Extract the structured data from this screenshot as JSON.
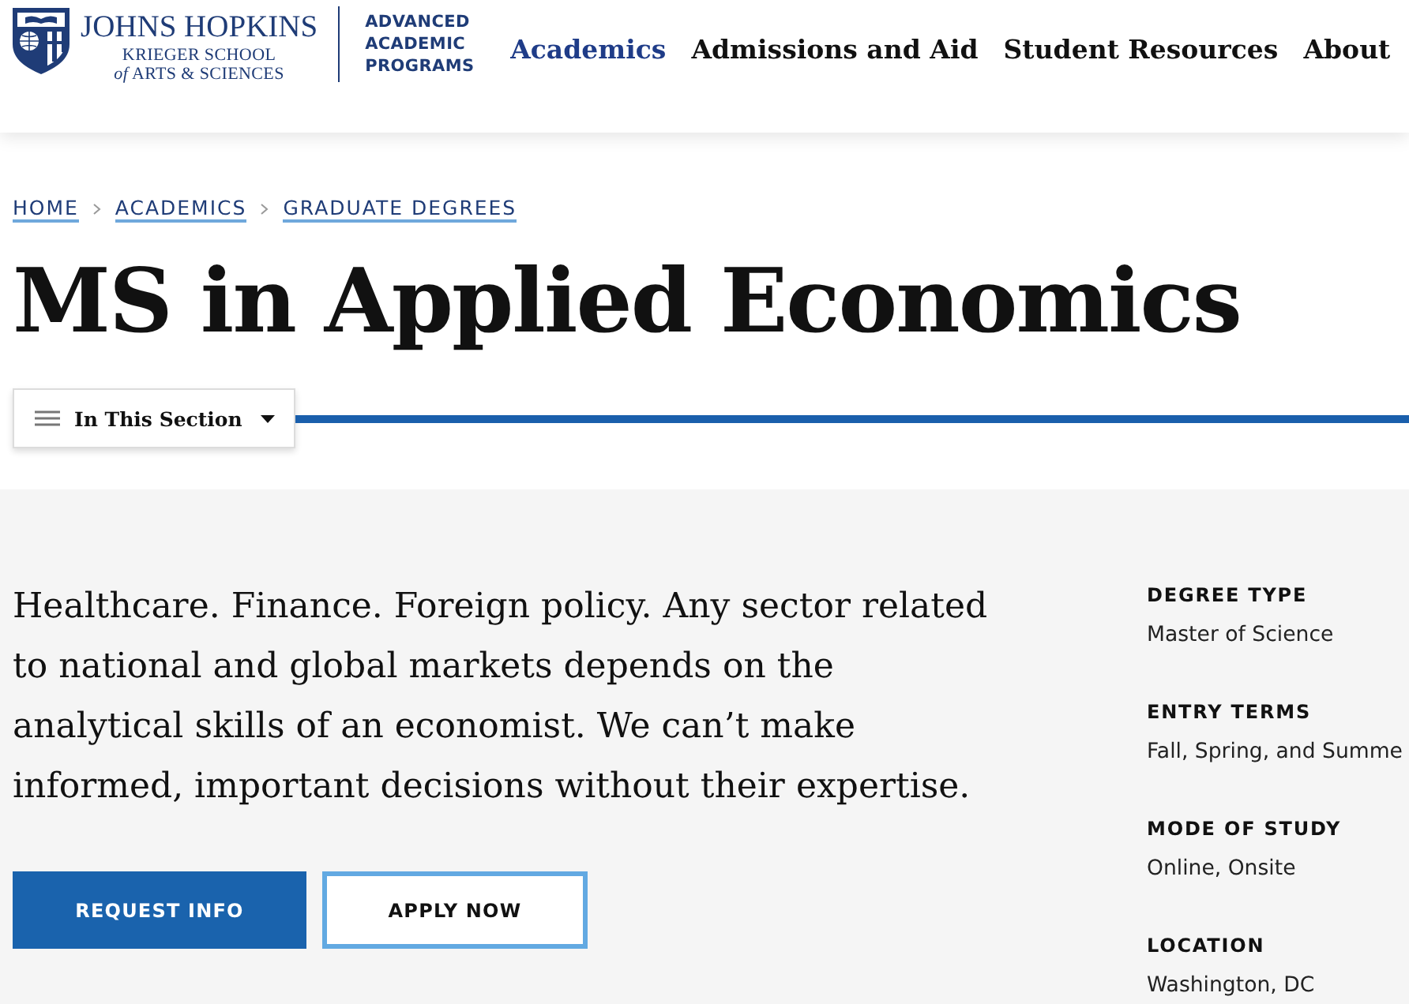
{
  "header": {
    "logo": {
      "name": "JOHNS HOPKINS",
      "school": "KRIEGER SCHOOL",
      "school_line_2": "*of* ARTS & SCIENCES",
      "program": "ADVANCED ACADEMIC PROGRAMS"
    },
    "nav": [
      {
        "label": "Academics",
        "selected": true
      },
      {
        "label": "Admissions and Aid",
        "selected": false
      },
      {
        "label": "Student Resources",
        "selected": false
      },
      {
        "label": "About",
        "selected": false
      }
    ]
  },
  "breadcrumb": [
    {
      "label": "HOME"
    },
    {
      "label": "ACADEMICS"
    },
    {
      "label": "GRADUATE DEGREES"
    }
  ],
  "page_title": "MS in Applied Economics",
  "section_menu": {
    "label": "In This Section"
  },
  "intro": {
    "text": "Healthcare. Finance. Foreign policy. Any sector related to national and global markets depends on the analytical skills of an economist. We can’t make informed, important decisions without their expertise.",
    "buttons": [
      {
        "label": "REQUEST INFO",
        "kind": "primary"
      },
      {
        "label": "APPLY NOW",
        "kind": "outline"
      }
    ]
  },
  "facts": [
    {
      "label": "DEGREE TYPE",
      "value": "Master of Science"
    },
    {
      "label": "ENTRY TERMS",
      "value": "Fall, Spring, and Summe"
    },
    {
      "label": "MODE OF STUDY",
      "value": "Online, Onsite"
    },
    {
      "label": "LOCATION",
      "value": "Washington, DC"
    }
  ]
}
